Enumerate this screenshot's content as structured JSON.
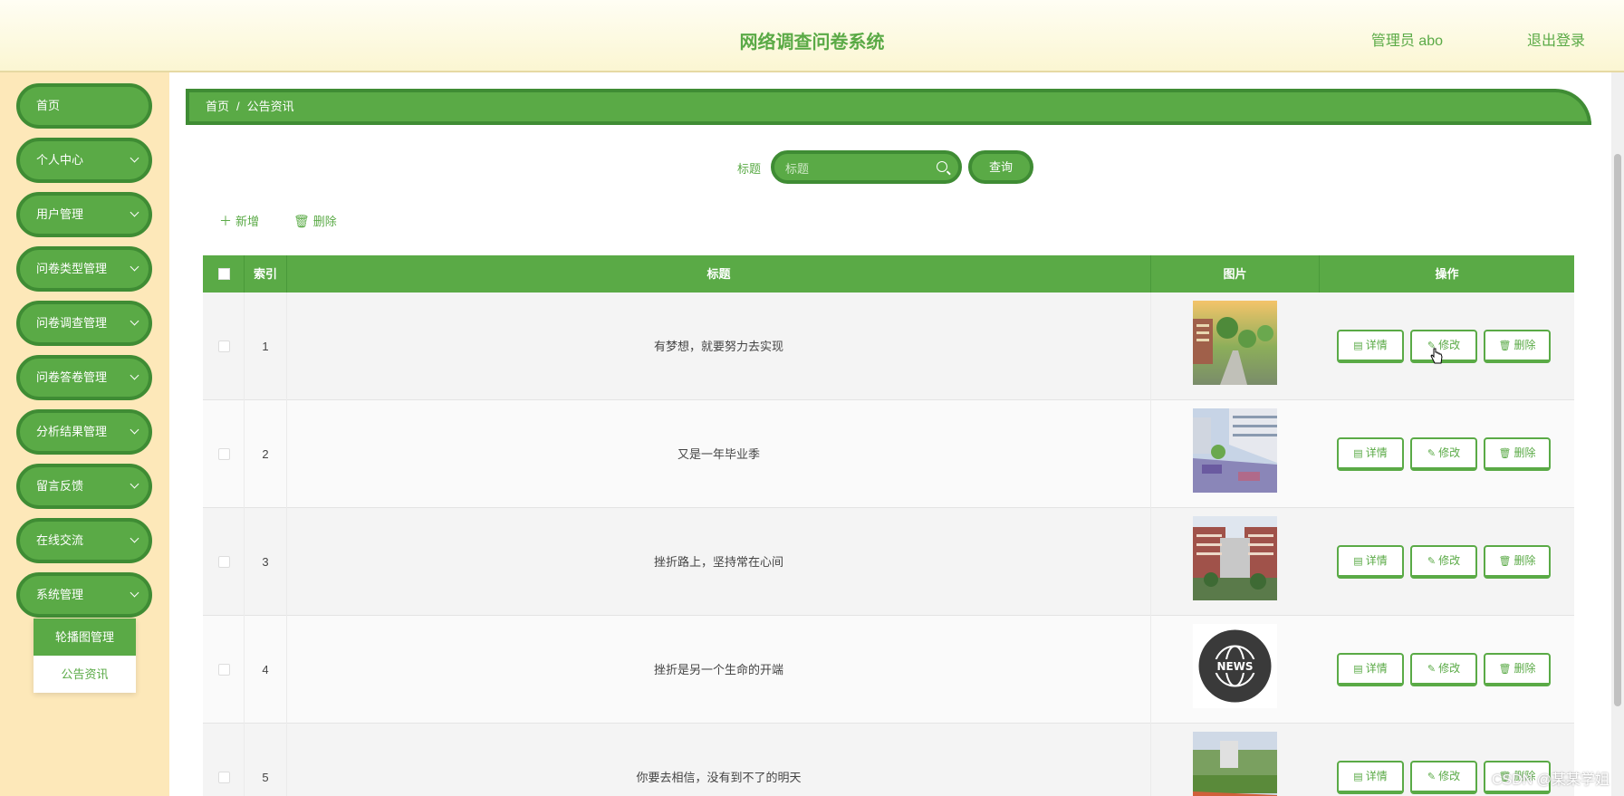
{
  "header": {
    "title": "网络调查问卷系统",
    "user": "管理员 abo",
    "logout": "退出登录"
  },
  "sidebar": {
    "items": [
      {
        "label": "首页"
      },
      {
        "label": "个人中心"
      },
      {
        "label": "用户管理"
      },
      {
        "label": "问卷类型管理"
      },
      {
        "label": "问卷调查管理"
      },
      {
        "label": "问卷答卷管理"
      },
      {
        "label": "分析结果管理"
      },
      {
        "label": "留言反馈"
      },
      {
        "label": "在线交流"
      },
      {
        "label": "系统管理"
      }
    ],
    "submenu": [
      {
        "label": "轮播图管理"
      },
      {
        "label": "公告资讯"
      }
    ]
  },
  "breadcrumb": {
    "home": "首页",
    "sep": "/",
    "current": "公告资讯"
  },
  "search": {
    "label": "标题",
    "placeholder": "标题",
    "query_label": "查询"
  },
  "toolbar": {
    "add_label": "新增",
    "delete_label": "删除"
  },
  "table": {
    "columns": [
      "索引",
      "标题",
      "图片",
      "操作"
    ],
    "rows": [
      {
        "index": "1",
        "title": "有梦想，就要努力去实现",
        "image": "campus-sunset"
      },
      {
        "index": "2",
        "title": "又是一年毕业季",
        "image": "campus-courtyard"
      },
      {
        "index": "3",
        "title": "挫折路上，坚持常在心间",
        "image": "campus-building"
      },
      {
        "index": "4",
        "title": "挫折是另一个生命的开端",
        "image": "news-logo"
      },
      {
        "index": "5",
        "title": "你要去相信，没有到不了的明天",
        "image": "campus-track"
      }
    ],
    "actions": {
      "detail": "详情",
      "edit": "修改",
      "delete": "删除"
    }
  },
  "watermark": "CSDN @某某学姐"
}
